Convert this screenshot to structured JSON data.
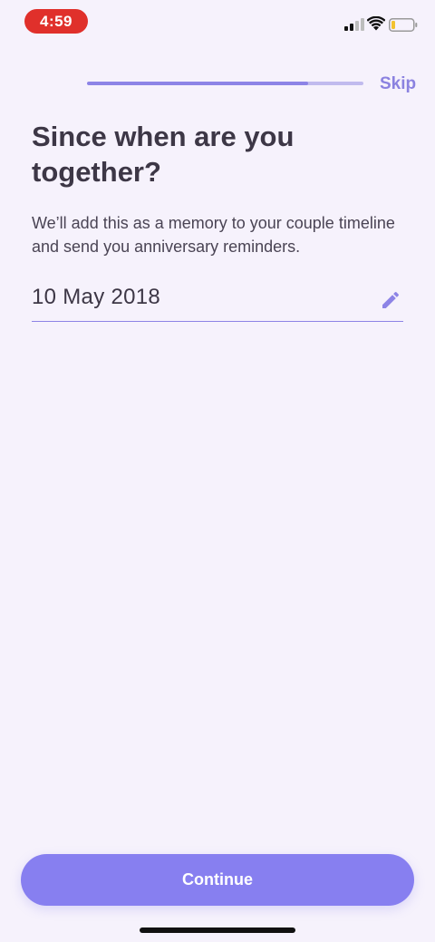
{
  "status_bar": {
    "time": "4:59"
  },
  "onboarding": {
    "progress_percent": 80,
    "skip_label": "Skip"
  },
  "header": {
    "title": "Since when are you together?",
    "subtitle": "We’ll add this as a memory to your couple timeline and send you anniversary reminders."
  },
  "date_field": {
    "value": "10 May 2018",
    "icon": "pencil-icon"
  },
  "footer": {
    "continue_label": "Continue"
  },
  "colors": {
    "background": "#f6f2fc",
    "accent": "#877ff0",
    "progress_fill": "#8d84e6",
    "progress_track": "#c1bbee",
    "time_pill": "#e0302b",
    "text_primary": "#3d3746"
  }
}
